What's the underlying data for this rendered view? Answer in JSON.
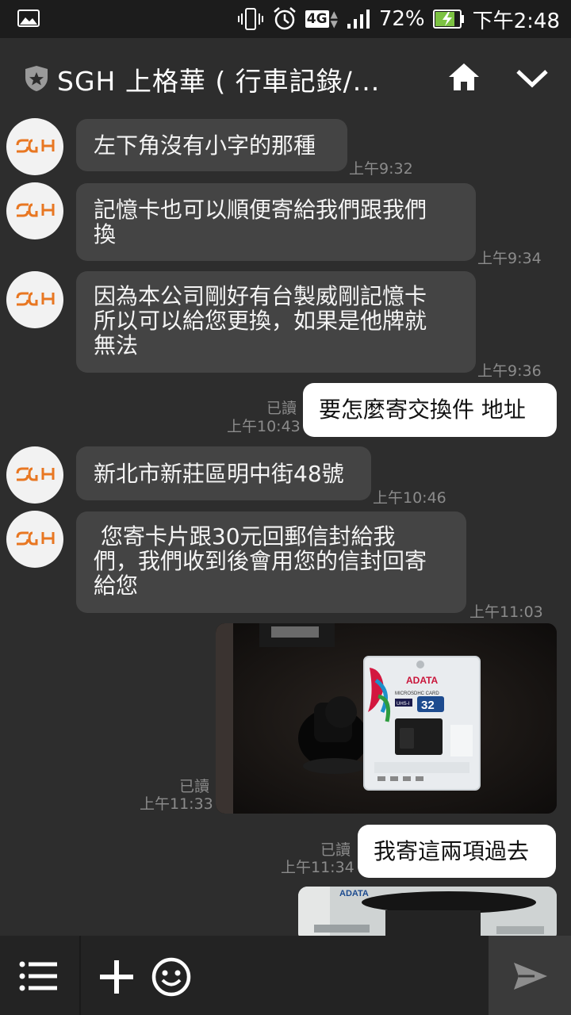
{
  "status_bar": {
    "network": "4G",
    "battery_percent": "72%",
    "time": "下午2:48",
    "icons": [
      "gallery-icon",
      "vibrate-icon",
      "alarm-icon",
      "network-4g-icon",
      "signal-icon",
      "battery-charging-icon"
    ]
  },
  "header": {
    "title": "SGH 上格華 ( 行車記錄/...",
    "icons": [
      "shield-star-icon",
      "home-icon",
      "chevron-down-icon"
    ]
  },
  "messages": [
    {
      "side": "in",
      "text": "左下角沒有小字的那種",
      "time": "上午9:32"
    },
    {
      "side": "in",
      "lines": [
        "記憶卡也可以順便寄給我們跟我們",
        "換"
      ],
      "time": "上午9:34"
    },
    {
      "side": "in",
      "lines": [
        "因為本公司剛好有台製威剛記憶卡",
        "所以可以給您更換，如果是他牌就",
        "無法"
      ],
      "time": "上午9:36"
    },
    {
      "side": "out",
      "text": "要怎麼寄交換件 地址",
      "read": "已讀",
      "time": "上午10:43"
    },
    {
      "side": "in",
      "text": "新北市新莊區明中街48號",
      "time": "上午10:46"
    },
    {
      "side": "in",
      "lines": [
        " 您寄卡片跟30元回郵信封給我",
        "們，我們收到後會用您的信封回寄",
        "給您"
      ],
      "time": "上午11:03"
    },
    {
      "side": "out",
      "type": "image",
      "image_text": [
        "ADATA",
        "MICROSDHC CARD",
        "32",
        "UHS-I"
      ],
      "read": "已讀",
      "time": "上午11:33"
    },
    {
      "side": "out",
      "text": "我寄這兩項過去",
      "read": "已讀",
      "time": "上午11:34"
    },
    {
      "side": "out",
      "type": "image",
      "image_text": [
        "ADATA"
      ]
    }
  ],
  "avatar_logo": "SGH",
  "colors": {
    "background": "#2d2d2d",
    "incoming_bubble": "#444444",
    "outgoing_bubble": "#ffffff",
    "logo_orange": "#e87722"
  },
  "bottom_bar": {
    "icons": [
      "menu-icon",
      "plus-icon",
      "emoji-icon",
      "send-icon"
    ]
  }
}
